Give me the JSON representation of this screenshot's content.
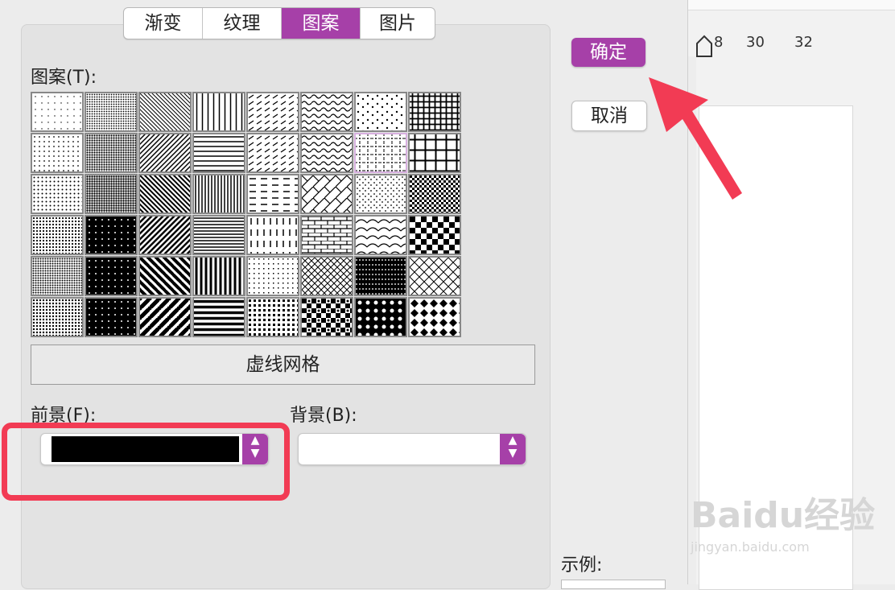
{
  "tabs": [
    {
      "label": "渐变",
      "active": false
    },
    {
      "label": "纹理",
      "active": false
    },
    {
      "label": "图案",
      "active": true
    },
    {
      "label": "图片",
      "active": false
    }
  ],
  "pattern_label": "图案(T):",
  "patterns": [
    "dots-sparse",
    "dots-dense-dark",
    "diag-right-thin",
    "vertical-lines",
    "dash-diag",
    "wave",
    "confetti",
    "grid-bold",
    "dots-small",
    "checker-dark-small",
    "diag-left",
    "horizontal-lines",
    "dash-diag-right",
    "wave-dense",
    "dashed-grid",
    "grid-large",
    "dots-medium",
    "dots-very-dense",
    "diag-right-wide",
    "vertical-dense",
    "dash-horizontal",
    "diagonal-brick",
    "dots-scatter",
    "checker-small",
    "dots-fine",
    "dots-black",
    "diag-left-wide",
    "horizontal-dense",
    "dash-vertical",
    "brick",
    "shingle",
    "checker-large",
    "sphere",
    "dots-black-large",
    "diag-right-bold",
    "vertical-bold",
    "confetti-small",
    "weave",
    "plaid",
    "trellis",
    "dots-grey",
    "dots-black-sparse",
    "diag-left-bold",
    "horizontal-bold",
    "divot",
    "zigzag-checker",
    "dots-checker",
    "diamonds"
  ],
  "selected_pattern_name": "虚线网格",
  "foreground_label": "前景(F):",
  "background_label": "背景(B):",
  "foreground_color": "#000000",
  "background_color": "#ffffff",
  "buttons": {
    "ok": "确定",
    "cancel": "取消"
  },
  "preview_label": "示例:",
  "ruler_ticks": [
    "8",
    "30",
    "32"
  ],
  "accent_color": "#a640a8",
  "annotation_color": "#f23b54",
  "watermark": {
    "main": "Baidu经验",
    "sub": "jingyan.baidu.com"
  }
}
